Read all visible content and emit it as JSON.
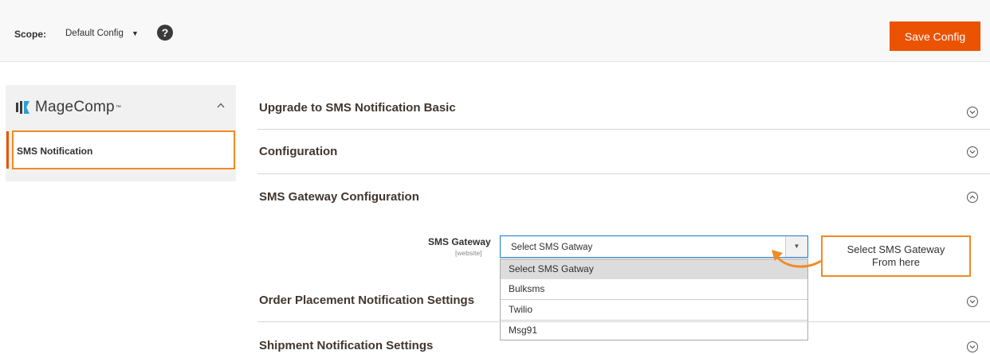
{
  "topbar": {
    "scope_label": "Scope:",
    "scope_value": "Default Config",
    "scope_caret": "▼",
    "help_icon": "?",
    "save_button": "Save Config"
  },
  "sidebar": {
    "brand_name": "MageComp",
    "brand_tm": "™",
    "collapse_icon": "^",
    "items": [
      {
        "label": "SMS Notification"
      }
    ]
  },
  "sections": [
    {
      "title": "Upgrade to SMS Notification Basic",
      "toggle": "v"
    },
    {
      "title": "Configuration",
      "toggle": "v"
    },
    {
      "title": "SMS Gateway Configuration",
      "toggle": "^"
    },
    {
      "title": "Order Placement Notification Settings",
      "toggle": "v"
    },
    {
      "title": "Shipment Notification Settings",
      "toggle": "v"
    }
  ],
  "gateway_field": {
    "label": "SMS Gateway",
    "scope": "[website]",
    "selected": "Select SMS Gatway",
    "options": [
      "Select SMS Gatway",
      "Bulksms",
      "Twilio",
      "Msg91"
    ]
  },
  "callout": {
    "line1": "Select SMS Gateway",
    "line2": "From here"
  },
  "colors": {
    "accent": "#eb5202",
    "highlight": "#f08a24",
    "focus": "#1979c3"
  }
}
